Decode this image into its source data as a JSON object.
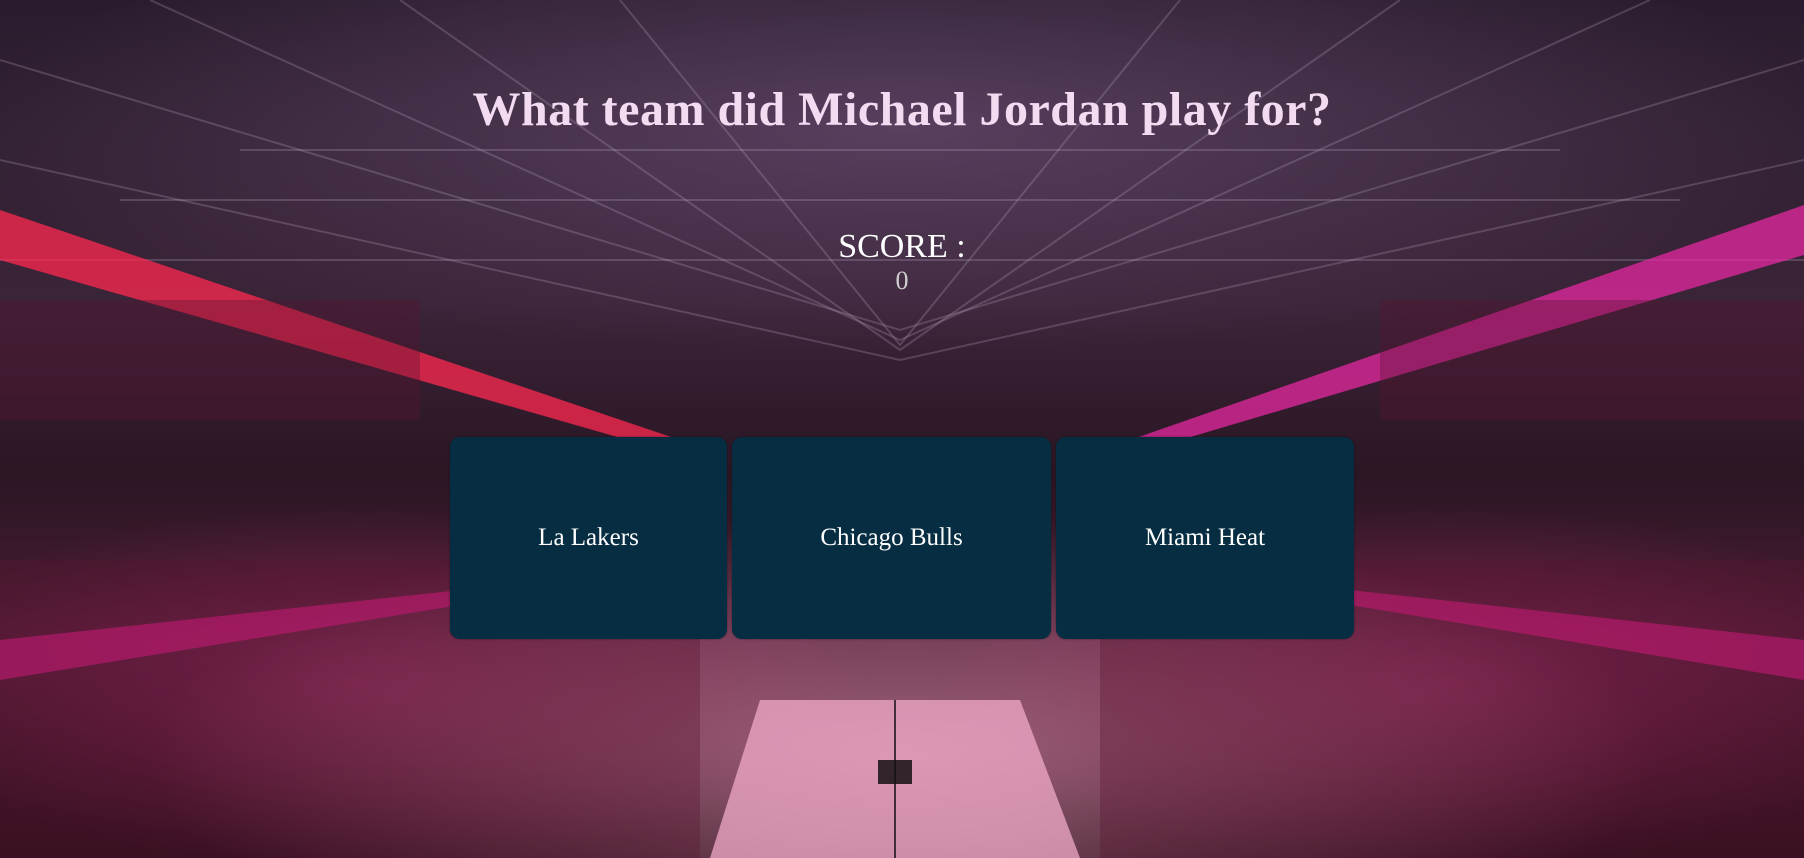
{
  "question": "What team did Michael Jordan play for?",
  "score": {
    "label": "SCORE :",
    "value": "0"
  },
  "answers": [
    {
      "label": "La Lakers"
    },
    {
      "label": "Chicago Bulls"
    },
    {
      "label": "Miami Heat"
    }
  ],
  "colors": {
    "answer_background": "#062d41",
    "question_text": "#f3dcf2"
  }
}
